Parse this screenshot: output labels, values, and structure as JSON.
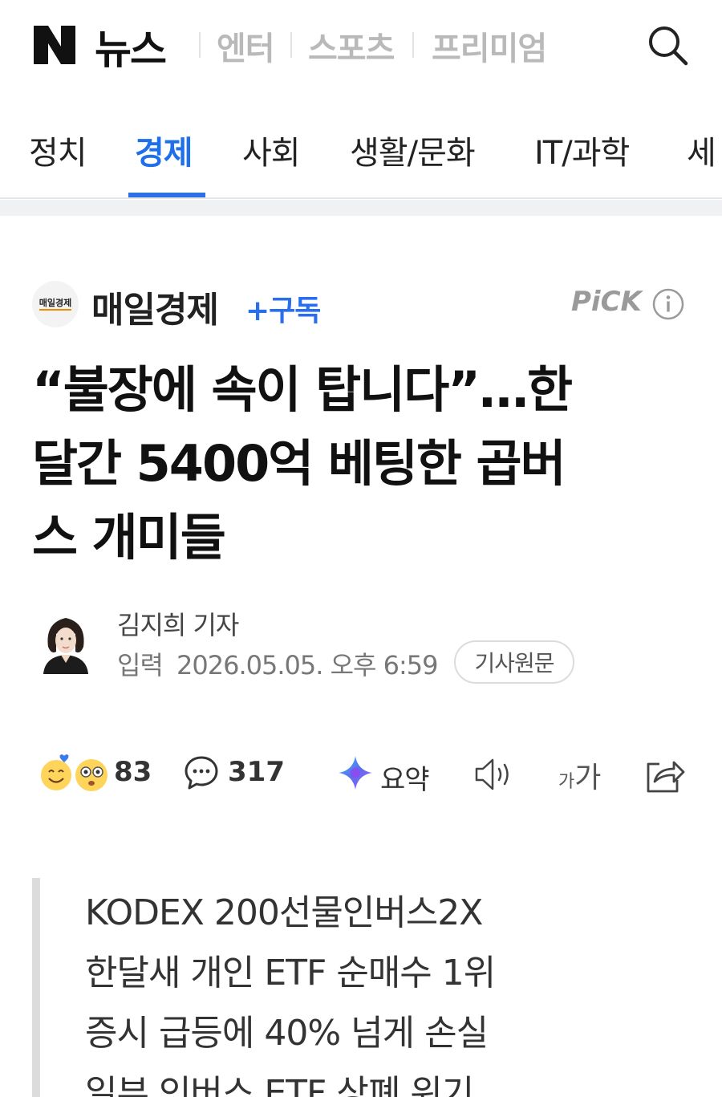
{
  "header": {
    "brand": "뉴스",
    "sections": [
      "엔터",
      "스포츠",
      "프리미엄"
    ]
  },
  "icons": {
    "logo": "naver-n-logo",
    "search": "search-icon",
    "info": "info-icon",
    "comment": "comment-icon",
    "summary": "sparkle-icon",
    "speaker": "speaker-icon",
    "share": "share-icon"
  },
  "nav": {
    "categories": [
      "정치",
      "경제",
      "사회",
      "생활/문화",
      "IT/과학",
      "세"
    ],
    "active_index": 1
  },
  "article": {
    "press": {
      "logo_text": "매일경제",
      "name": "매일경제",
      "subscribe": "+구독",
      "pick": "PiCK"
    },
    "headline_lines": [
      "“불장에 속이 탑니다”…한",
      "달간 5400억 베팅한 곱버",
      "스 개미들"
    ],
    "reporter": "김지희 기자",
    "date_label": "입력",
    "date": "2026.05.05. 오후 6:59",
    "original_button": "기사원문"
  },
  "actions": {
    "reaction_count": "83",
    "comment_count": "317",
    "summary_label": "요약",
    "font_small": "가",
    "font_big": "가"
  },
  "summary": {
    "lines": [
      "KODEX 200선물인버스2X",
      "한달새 개인 ETF 순매수 1위",
      "증시 급등에 40% 넘게 손실",
      "일부 인버스 ETF 상폐 위기"
    ]
  },
  "colors": {
    "accent": "#2f6fe4",
    "subscribe": "#2a6ef0",
    "muted": "#b9b9b9"
  }
}
